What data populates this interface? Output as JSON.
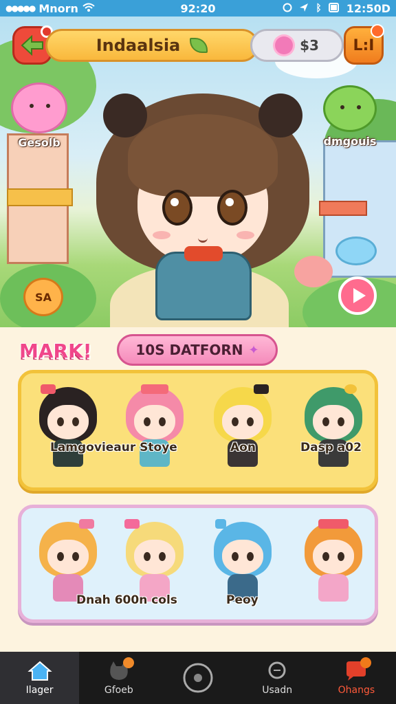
{
  "status_bar": {
    "carrier": "Mnorn",
    "time": "92:20",
    "right_text": "12:50D"
  },
  "header": {
    "title": "Indaalsia",
    "currency_value": "$3",
    "menu_label": "L:I"
  },
  "scene": {
    "left_mascot_label": "Gesolb",
    "right_mascot_label": "dmgouis",
    "bottom_left_badge": "SA"
  },
  "section": {
    "title": "MARK!",
    "platform_button": "10S DATFORN"
  },
  "card_yellow": {
    "labels": [
      "Lamgovieaur Stoye",
      "Aon",
      "Dasp a02"
    ]
  },
  "card_blue": {
    "labels": [
      "Dnah 600n cols",
      "Peoy"
    ]
  },
  "tabbar": {
    "tabs": [
      {
        "label": "Ilager"
      },
      {
        "label": "Gfoeb"
      },
      {
        "label": ""
      },
      {
        "label": "Usadn"
      },
      {
        "label": "Ohangs"
      }
    ]
  },
  "colors": {
    "accent_pink": "#f0468a",
    "header_orange": "#f9b83c",
    "play_pink": "#ff6b8e",
    "tab_active_icon": "#4ab3f4",
    "tab_alert": "#ff5a3a"
  }
}
